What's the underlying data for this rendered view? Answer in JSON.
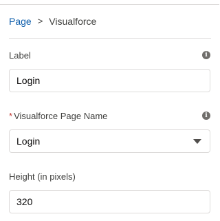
{
  "breadcrumb": {
    "parent": "Page",
    "separator": ">",
    "current": "Visualforce"
  },
  "fields": {
    "label": {
      "label": "Label",
      "value": "Login",
      "info_icon": "info-icon"
    },
    "page_name": {
      "required_marker": "*",
      "label": "Visualforce Page Name",
      "selected": "Login",
      "info_icon": "info-icon",
      "dropdown_icon": "chevron-down-icon"
    },
    "height": {
      "label": "Height (in pixels)",
      "value": "320"
    }
  },
  "colors": {
    "link": "#0b5cab",
    "required": "#c23934",
    "border": "#dddbda",
    "text": "#3e3e3c"
  }
}
